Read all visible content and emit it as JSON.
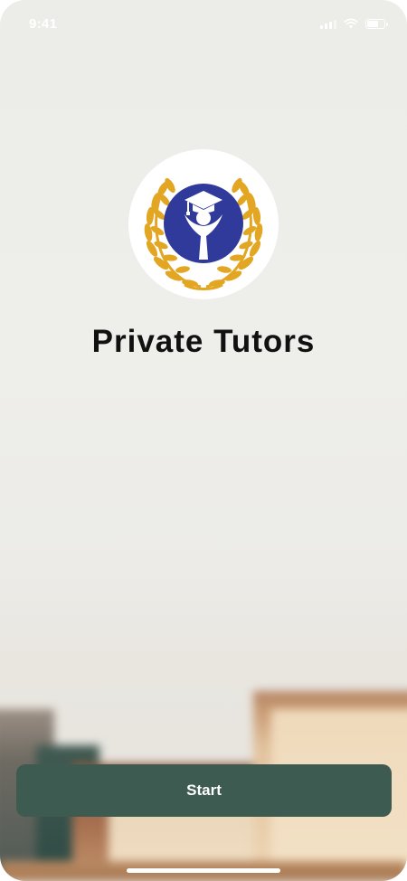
{
  "status_bar": {
    "time": "9:41",
    "icons": [
      "signal-icon",
      "wifi-icon",
      "battery-icon"
    ]
  },
  "logo": {
    "icon": "graduation-cap-laurel-logo",
    "colors": {
      "laurel": "#e3a623",
      "emblem": "#303a9a",
      "background": "#ffffff"
    }
  },
  "app_title": "Private Tutors",
  "start_button": {
    "label": "Start",
    "color": "#3d5b50"
  }
}
